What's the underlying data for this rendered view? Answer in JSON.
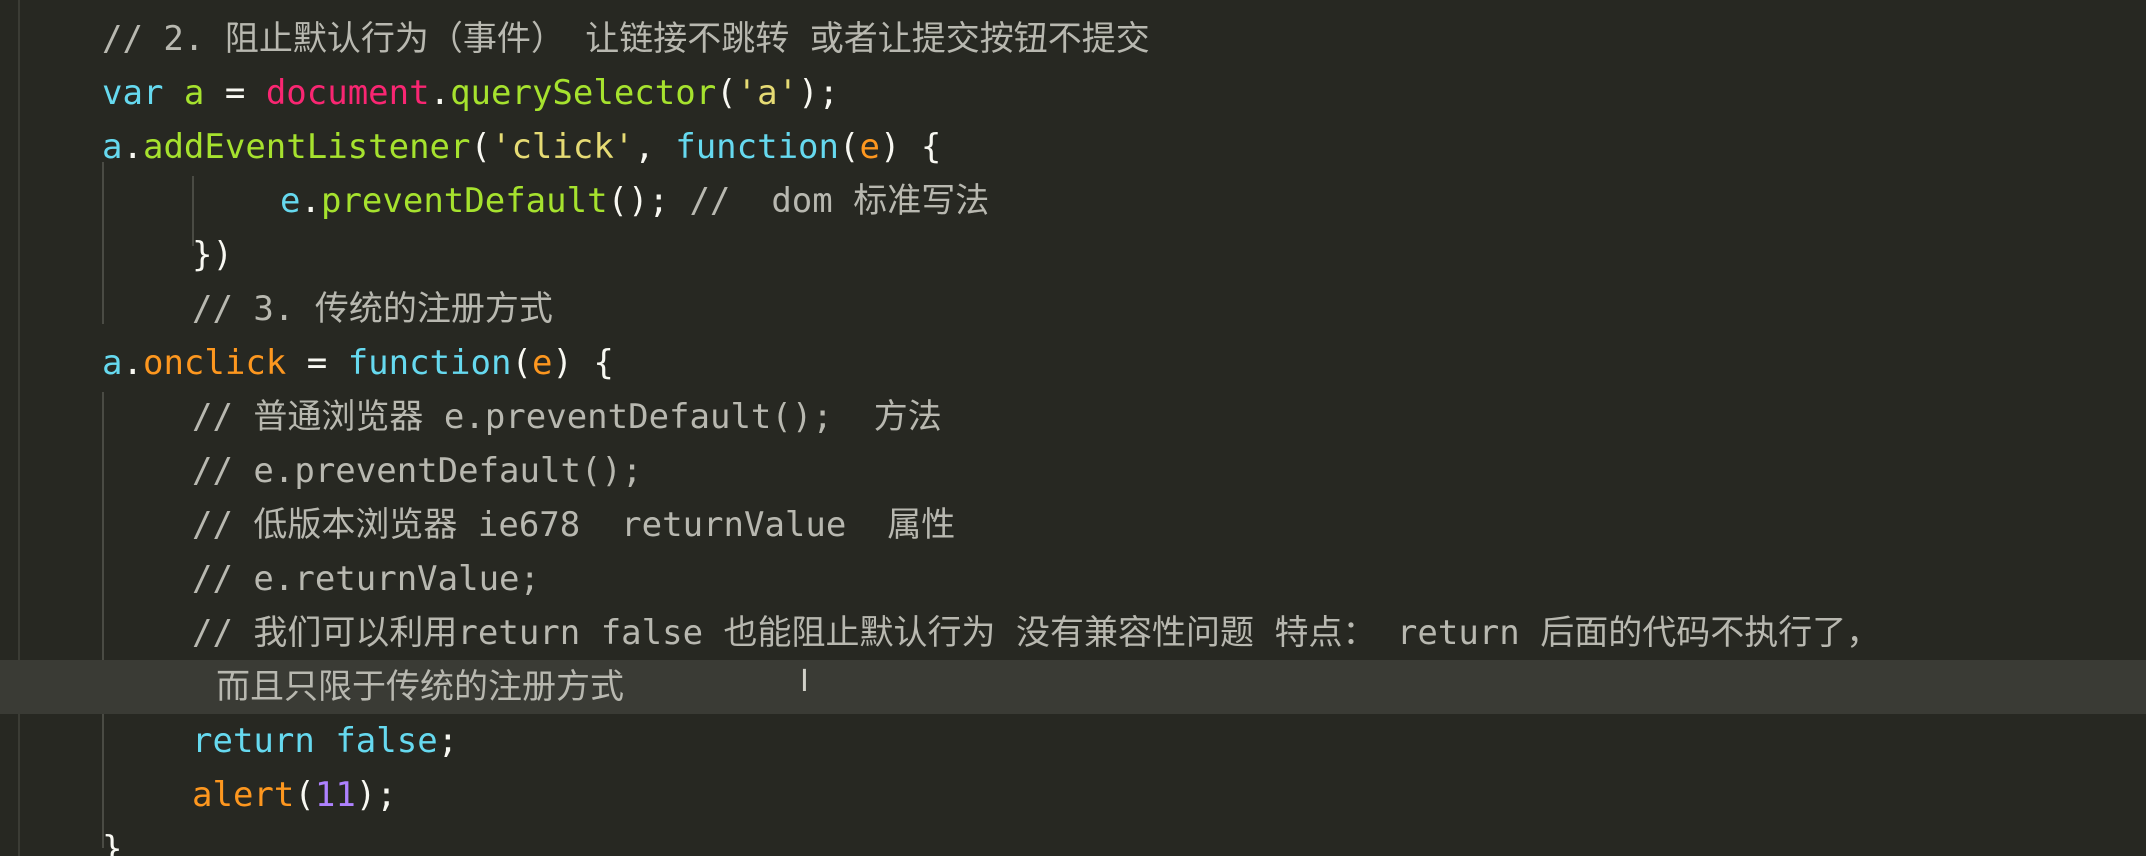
{
  "lines": {
    "l1": {
      "comment": "// 2. 阻止默认行为（事件） 让链接不跳转 或者让提交按钮不提交"
    },
    "l2": {
      "kw": "var",
      "name": "a",
      "eq": " = ",
      "obj": "document",
      "dot": ".",
      "method": "querySelector",
      "open": "(",
      "str": "'a'",
      "close": ");"
    },
    "l3": {
      "obj": "a",
      "dot": ".",
      "method": "addEventListener",
      "open": "(",
      "str": "'click'",
      "comma": ", ",
      "kw": "function",
      "p1": "(",
      "param": "e",
      "p2": ") {"
    },
    "l4": {
      "param": "e",
      "dot": ".",
      "method": "preventDefault",
      "rest": "(); ",
      "comment": "//  dom 标准写法"
    },
    "l5": {
      "text": "})"
    },
    "l6": {
      "comment": "// 3. 传统的注册方式"
    },
    "l7": {
      "obj": "a",
      "dot": ".",
      "method": "onclick",
      "eq": " = ",
      "kw": "function",
      "p1": "(",
      "param": "e",
      "p2": ") {"
    },
    "l8": {
      "comment": "// 普通浏览器 e.preventDefault();  方法"
    },
    "l9": {
      "comment": "// e.preventDefault();"
    },
    "l10": {
      "comment": "// 低版本浏览器 ie678  returnValue  属性"
    },
    "l11": {
      "comment": "// e.returnValue;"
    },
    "l12": {
      "comment": "// 我们可以利用return false 也能阻止默认行为 没有兼容性问题 特点： return 后面的代码不执行了，"
    },
    "l13": {
      "comment": "而且只限于传统的注册方式"
    },
    "l14": {
      "kw": "return",
      "sp": " ",
      "val": "false",
      "semi": ";"
    },
    "l15": {
      "fn": "alert",
      "open": "(",
      "num": "11",
      "close": ");"
    },
    "l16": {
      "text": "}"
    }
  },
  "cursor_icon": "text-cursor-icon",
  "colors": {
    "background": "#272822",
    "keyword": "#66d9ef",
    "function": "#a6e22e",
    "object": "#f92672",
    "string": "#e6db74",
    "parameter": "#fd971f",
    "comment": "#b8b8b0",
    "number": "#ae81ff"
  }
}
